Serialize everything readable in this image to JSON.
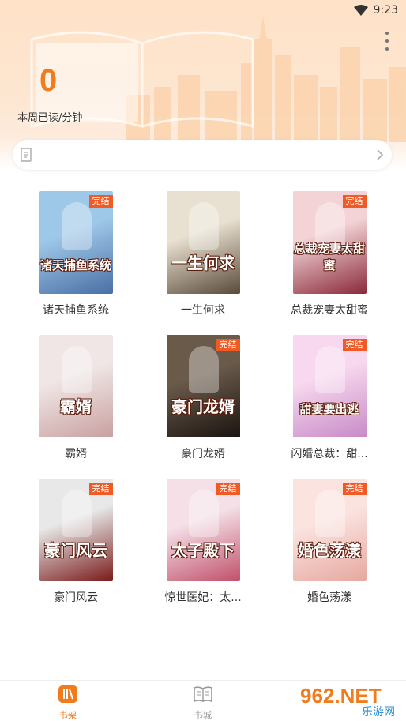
{
  "status_bar": {
    "time": "9:23"
  },
  "header": {
    "read_count": "0",
    "read_label": "本周已读/分钟"
  },
  "books": [
    {
      "title": "诸天捕鱼系统",
      "cover_text": "诸天捕鱼系统",
      "completed": true,
      "badge": "完结",
      "colors": [
        "#9ec8e8",
        "#4a6fa5"
      ]
    },
    {
      "title": "一生何求",
      "cover_text": "一生何求",
      "completed": false,
      "badge": "",
      "colors": [
        "#e8e0d0",
        "#5a4a3a"
      ]
    },
    {
      "title": "总裁宠妻太甜蜜",
      "cover_text": "总裁宠妻太甜蜜",
      "completed": true,
      "badge": "完结",
      "colors": [
        "#f3d3d6",
        "#8a2a3a"
      ]
    },
    {
      "title": "霸婿",
      "cover_text": "霸婿",
      "completed": false,
      "badge": "",
      "colors": [
        "#f0e6e6",
        "#c9a0a0"
      ]
    },
    {
      "title": "豪门龙婿",
      "cover_text": "豪门龙婿",
      "completed": true,
      "badge": "完结",
      "colors": [
        "#6a5a4a",
        "#1a1410"
      ]
    },
    {
      "title": "闪婚总裁：甜...",
      "cover_text": "甜妻要出逃",
      "completed": true,
      "badge": "完结",
      "colors": [
        "#f7d8ee",
        "#c88ac8"
      ]
    },
    {
      "title": "豪门风云",
      "cover_text": "豪门风云",
      "completed": true,
      "badge": "完结",
      "colors": [
        "#e8e8e8",
        "#7a1a1a"
      ]
    },
    {
      "title": "惊世医妃：太...",
      "cover_text": "太子殿下",
      "completed": true,
      "badge": "完结",
      "colors": [
        "#f5e0e8",
        "#c0506a"
      ]
    },
    {
      "title": "婚色荡漾",
      "cover_text": "婚色荡漾",
      "completed": true,
      "badge": "完结",
      "colors": [
        "#fbe4e0",
        "#e6a8a0"
      ]
    }
  ],
  "tabs": [
    {
      "label": "书架",
      "active": true
    },
    {
      "label": "书城",
      "active": false
    }
  ],
  "watermark": {
    "text": "962.NET",
    "sub": "乐游网"
  },
  "colors": {
    "accent": "#f07c1e",
    "badge": "#f15a24"
  }
}
